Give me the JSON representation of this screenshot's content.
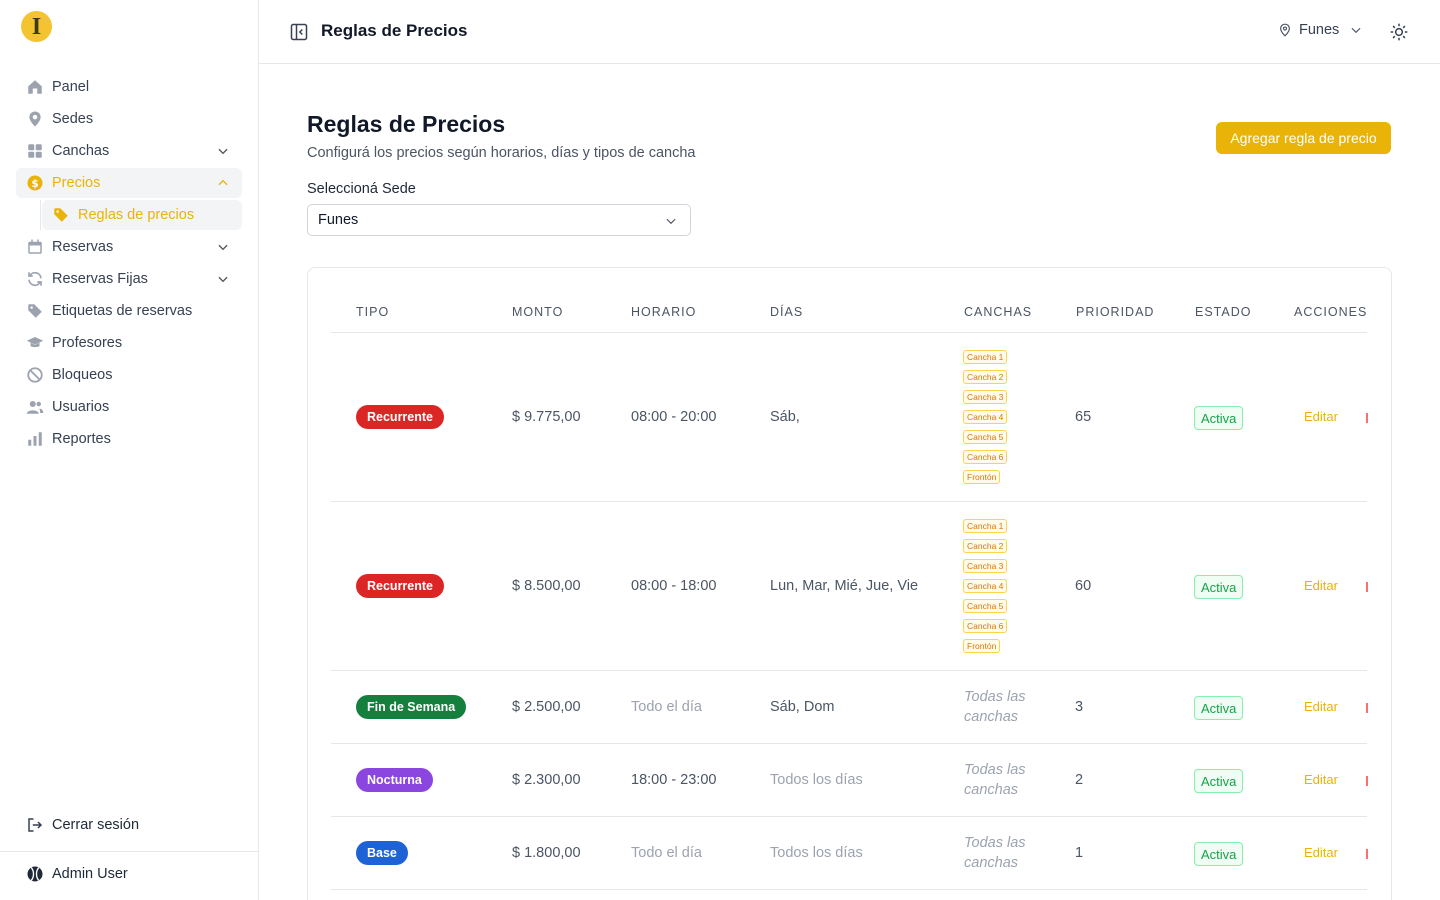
{
  "sidebar": {
    "logo_letter": "I",
    "items": [
      {
        "label": "Panel",
        "icon": "home-icon"
      },
      {
        "label": "Sedes",
        "icon": "location-pin-icon"
      },
      {
        "label": "Canchas",
        "icon": "grid-icon"
      },
      {
        "label": "Precios",
        "icon": "dollar-icon"
      },
      {
        "label": "Reservas",
        "icon": "calendar-icon"
      },
      {
        "label": "Reservas Fijas",
        "icon": "refresh-icon"
      },
      {
        "label": "Etiquetas de reservas",
        "icon": "tag-icon"
      },
      {
        "label": "Profesores",
        "icon": "graduation-cap-icon"
      },
      {
        "label": "Bloqueos",
        "icon": "block-icon"
      },
      {
        "label": "Usuarios",
        "icon": "users-icon"
      },
      {
        "label": "Reportes",
        "icon": "bar-chart-icon"
      }
    ],
    "sub_item": {
      "label": "Reglas de precios",
      "icon": "tag-icon"
    },
    "logout_label": "Cerrar sesión",
    "user_name": "Admin User",
    "accent": "#eab308"
  },
  "header": {
    "title": "Reglas de Precios",
    "venue": "Funes"
  },
  "main": {
    "title": "Reglas de Precios",
    "subtitle": "Configurá los precios según horarios, días y tipos de cancha",
    "add_button": "Agregar regla de precio",
    "sede_label": "Seleccioná Sede",
    "sede_value": "Funes"
  },
  "table": {
    "headers": [
      "TIPO",
      "MONTO",
      "HORARIO",
      "DÍAS",
      "CANCHAS",
      "PRIORIDAD",
      "ESTADO",
      "ACCIONES"
    ],
    "rows": [
      {
        "tipo": "Recurrente",
        "tipo_color": "#dc2626",
        "monto": "$ 9.775,00",
        "horario": "08:00 - 20:00",
        "dias": "Sáb,",
        "canchas": [
          "Cancha 1",
          "Cancha 2",
          "Cancha 3",
          "Cancha 4",
          "Cancha 5",
          "Cancha 6",
          "Frontón"
        ],
        "prioridad": "65",
        "estado": "Activa",
        "accion": "Editar"
      },
      {
        "tipo": "Recurrente",
        "tipo_color": "#dc2626",
        "monto": "$ 8.500,00",
        "horario": "08:00 - 18:00",
        "dias": "Lun, Mar, Mié, Jue, Vie",
        "canchas": [
          "Cancha 1",
          "Cancha 2",
          "Cancha 3",
          "Cancha 4",
          "Cancha 5",
          "Cancha 6",
          "Frontón"
        ],
        "prioridad": "60",
        "estado": "Activa",
        "accion": "Editar"
      },
      {
        "tipo": "Fin de Semana",
        "tipo_color": "#15803d",
        "monto": "$ 2.500,00",
        "horario": "Todo el día",
        "dias": "Sáb, Dom",
        "canchas_text": "Todas las canchas",
        "prioridad": "3",
        "estado": "Activa",
        "accion": "Editar"
      },
      {
        "tipo": "Nocturna",
        "tipo_color": "#8b46e0",
        "monto": "$ 2.300,00",
        "horario": "18:00 - 23:00",
        "dias": "Todos los días",
        "canchas_text": "Todas las canchas",
        "prioridad": "2",
        "estado": "Activa",
        "accion": "Editar"
      },
      {
        "tipo": "Base",
        "tipo_color": "#1d63d6",
        "monto": "$ 1.800,00",
        "horario": "Todo el día",
        "dias": "Todos los días",
        "canchas_text": "Todas las canchas",
        "prioridad": "1",
        "estado": "Activa",
        "accion": "Editar"
      }
    ]
  }
}
